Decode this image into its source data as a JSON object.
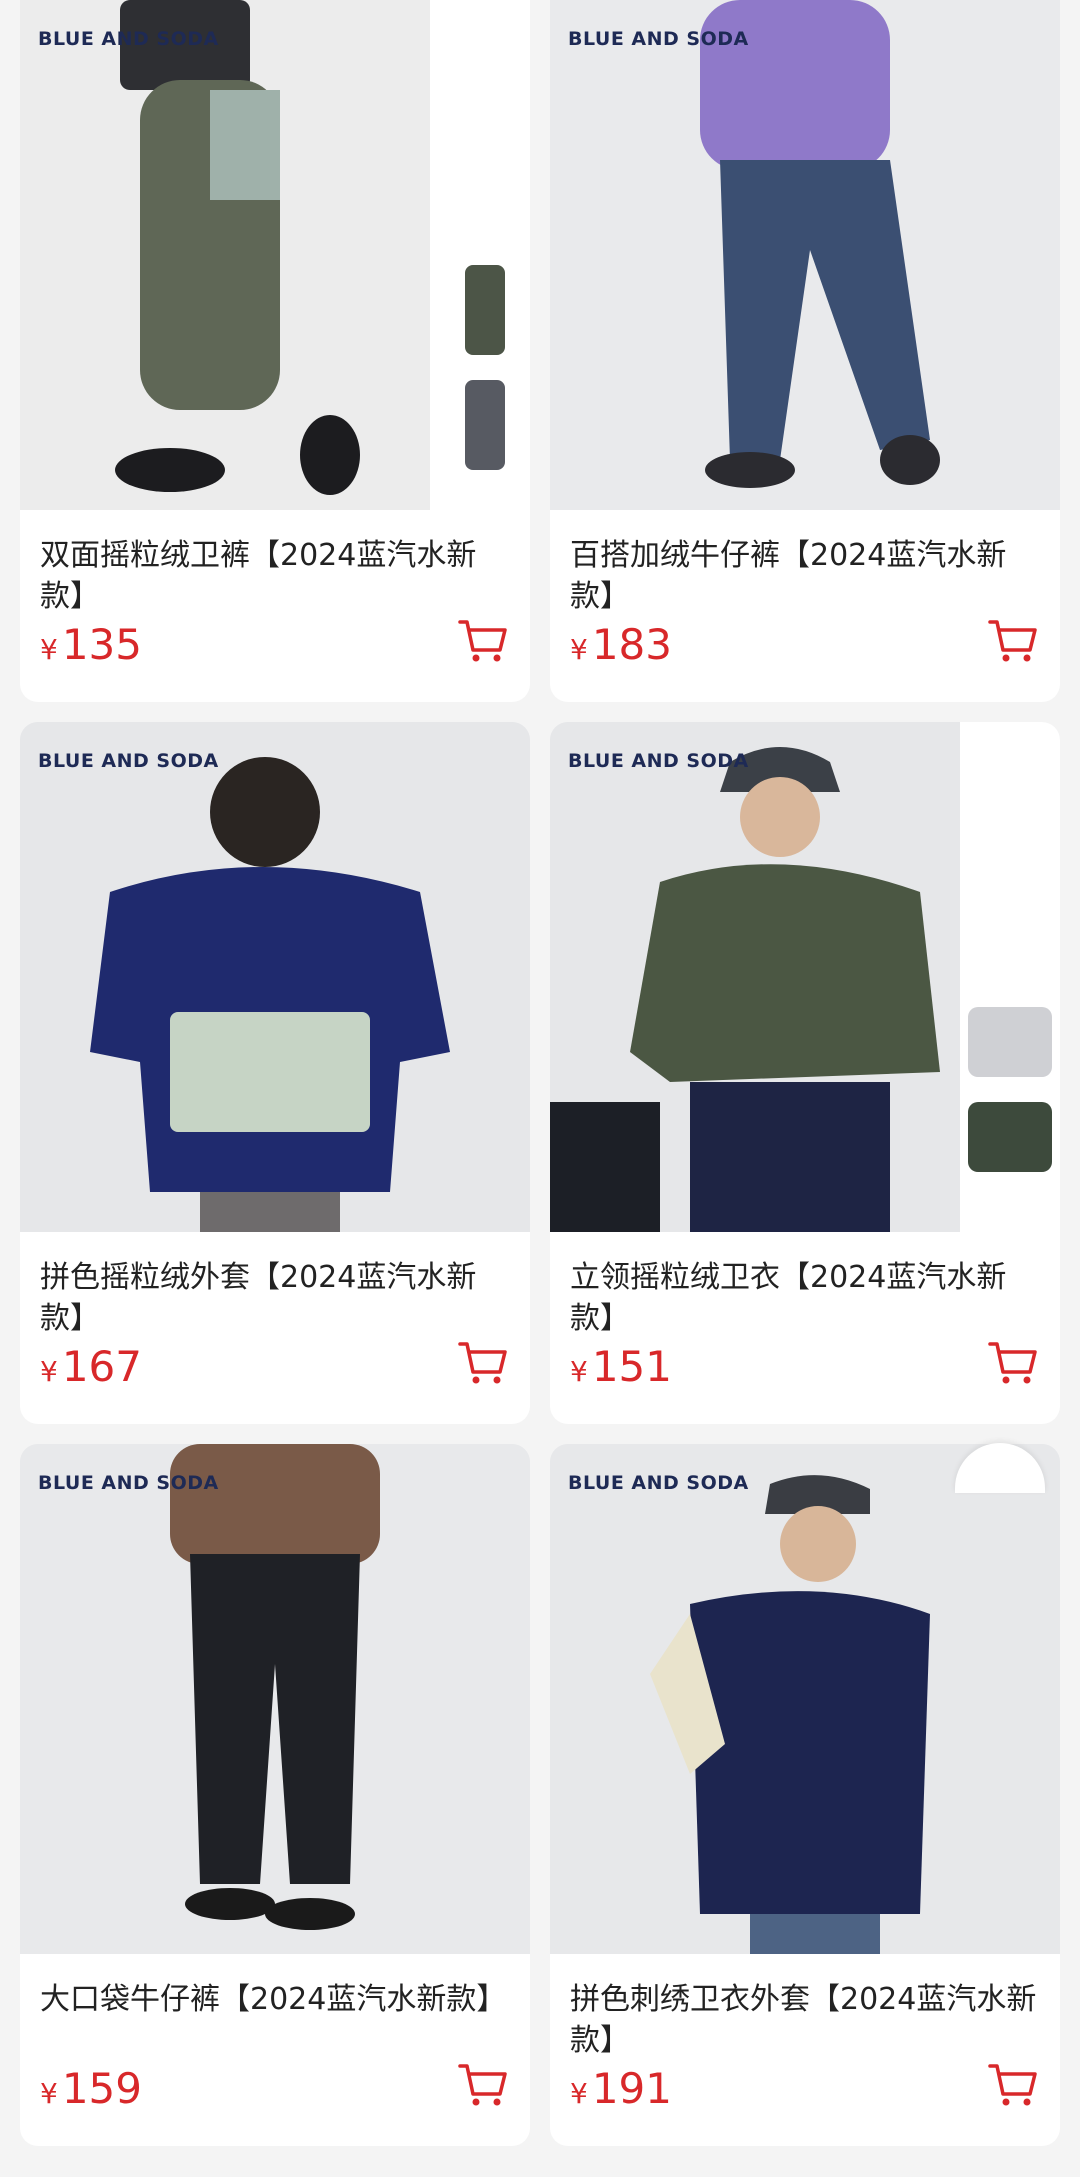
{
  "products": [
    {
      "brand": "BLUE AND SODA",
      "title": "双面摇粒绒卫裤【2024蓝汽水新款】",
      "currency": "¥",
      "price": "135"
    },
    {
      "brand": "BLUE AND SODA",
      "title": "百搭加绒牛仔裤【2024蓝汽水新款】",
      "currency": "¥",
      "price": "183"
    },
    {
      "brand": "BLUE AND SODA",
      "title": "拼色摇粒绒外套【2024蓝汽水新款】",
      "currency": "¥",
      "price": "167"
    },
    {
      "brand": "BLUE AND SODA",
      "title": "立领摇粒绒卫衣【2024蓝汽水新款】",
      "currency": "¥",
      "price": "151"
    },
    {
      "brand": "BLUE AND SODA",
      "title": "大口袋牛仔裤【2024蓝汽水新款】",
      "currency": "¥",
      "price": "159"
    },
    {
      "brand": "BLUE AND SODA",
      "title": "拼色刺绣卫衣外套【2024蓝汽水新款】",
      "currency": "¥",
      "price": "191"
    }
  ],
  "icons": {
    "cart": "shopping-cart-icon"
  },
  "colors": {
    "price": "#d8282a",
    "brand": "#1e2a55",
    "background": "#f4f4f4"
  }
}
